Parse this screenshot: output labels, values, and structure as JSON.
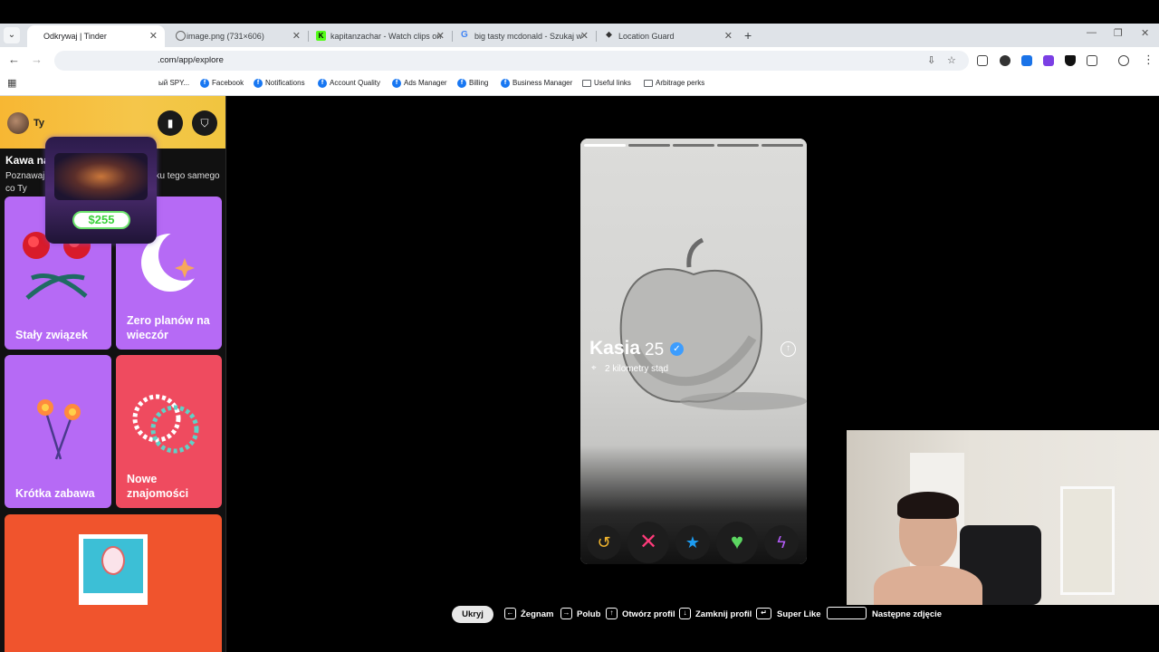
{
  "browser": {
    "tabs": [
      {
        "title": "Odkrywaj | Tinder",
        "active": true
      },
      {
        "title": "image.png (731×606)"
      },
      {
        "title": "kapitanzachar - Watch clips on"
      },
      {
        "title": "big tasty mcdonald - Szukaj w"
      },
      {
        "title": "Location Guard"
      }
    ],
    "url": ".com/app/explore",
    "bookmarks": [
      "ый SPY...",
      "Facebook",
      "Notifications",
      "Account Quality",
      "Ads Manager",
      "Billing",
      "Business Manager",
      "Useful links",
      "Arbitrage perks"
    ]
  },
  "sidebar": {
    "username": "Ty",
    "section_title": "Kawa na ławę",
    "section_subtitle": "Poznawaj osoby, które chcą od związku tego samego co Ty",
    "cards": [
      {
        "label": "Stały związek",
        "color": "#b66af5"
      },
      {
        "label": "Zero planów na wieczór",
        "color": "#b66af5"
      },
      {
        "label": "Krótka zabawa",
        "color": "#b66af5"
      },
      {
        "label": "Nowe znajomości",
        "color": "#ef4b5f"
      },
      {
        "label": "",
        "color": "#f0542d"
      }
    ]
  },
  "sticker": {
    "amount": "$255"
  },
  "profile": {
    "name": "Kasia",
    "age": "25",
    "distance": "2 kilometry stąd",
    "photo_count": 5,
    "current_photo": 1
  },
  "actions": [
    "rewind-icon",
    "nope-icon",
    "super-like-icon",
    "like-icon",
    "boost-icon"
  ],
  "shortcuts": {
    "hide": "Ukryj",
    "nope": "Żegnam",
    "like": "Polub",
    "open_profile": "Otwórz profil",
    "close_profile": "Zamknij profil",
    "super_like": "Super Like",
    "next_photo": "Następne zdjęcie"
  }
}
